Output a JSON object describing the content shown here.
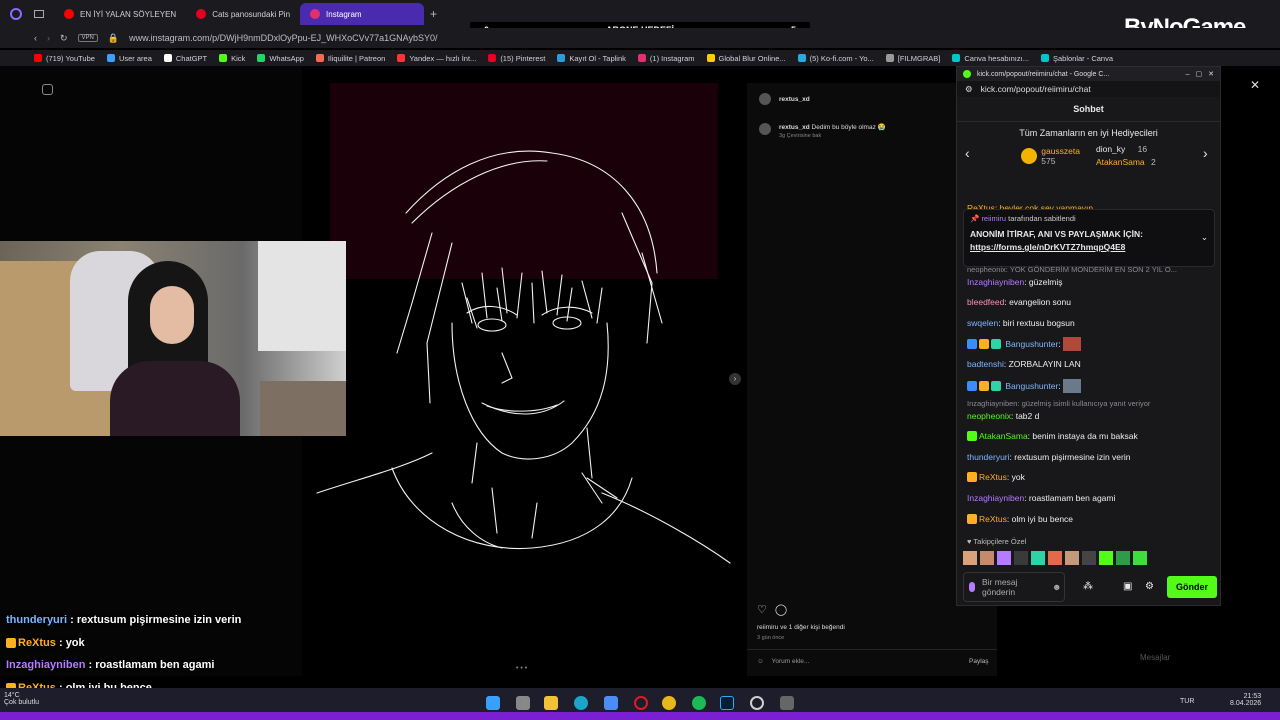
{
  "browser": {
    "tabs": [
      {
        "label": "EN İYİ YALAN SÖYLEYEN",
        "color": "#ff0000",
        "active": false
      },
      {
        "label": "Cats panosundaki Pin",
        "color": "#e60023",
        "active": false
      },
      {
        "label": "Instagram",
        "color": "#e1306c",
        "active": true
      }
    ],
    "url": "www.instagram.com/p/DWjH9nmDDxlOyPpu-EJ_WHXoCVv77a1GNAybSY0/",
    "vpn_label": "VPN",
    "bookmarks": [
      {
        "label": "(719) YouTube",
        "color": "#ff0000"
      },
      {
        "label": "User area",
        "color": "#3aa0ff"
      },
      {
        "label": "ChatGPT",
        "color": "#ffffff"
      },
      {
        "label": "Kick",
        "color": "#53fc18"
      },
      {
        "label": "WhatsApp",
        "color": "#25d366"
      },
      {
        "label": "Iliquilite | Patreon",
        "color": "#f96854"
      },
      {
        "label": "Yandex — hızlı İnt...",
        "color": "#ff3333"
      },
      {
        "label": "(15) Pinterest",
        "color": "#e60023"
      },
      {
        "label": "Kayıt Ol - Taplink",
        "color": "#2d9cdb"
      },
      {
        "label": "(1) Instagram",
        "color": "#e1306c"
      },
      {
        "label": "Global Blur Online...",
        "color": "#ffcc00"
      },
      {
        "label": "(5) Ko-fi.com - Yo...",
        "color": "#29abe0"
      },
      {
        "label": "[FILMGRAB]",
        "color": "#999999"
      },
      {
        "label": "Canva hesabınızı...",
        "color": "#00c4cc"
      },
      {
        "label": "Şablonlar - Canva",
        "color": "#00c4cc"
      }
    ]
  },
  "overlay": {
    "goal_left": "0",
    "goal_label": "ABONE HEDEFİ",
    "goal_right": "5",
    "logo": "ByNoGame"
  },
  "post": {
    "username": "rextus_xd",
    "caption_user": "rextus_xd",
    "caption_text": "Dedim bu böyle olmaz 😭",
    "caption_time": "3g",
    "translate": "Çevirisine bak",
    "likes": "reiimiru ve 1 diğer kişi beğendi",
    "posted": "3 gün önce",
    "comment_placeholder": "Yorum ekle...",
    "share": "Paylaş"
  },
  "kick": {
    "window_title": "kick.com/popout/reiimiru/chat - Google C...",
    "url": "kick.com/popout/reiimiru/chat",
    "header": "Sohbet",
    "gifters_title": "Tüm Zamanların en iyi Hediyecileri",
    "gifters": [
      {
        "name": "gausszeta",
        "count": "575"
      },
      {
        "name": "dion_ky",
        "count": "16"
      },
      {
        "name": "AtakanSama",
        "count": "2"
      }
    ],
    "peek_line": "ReXtus: beyler çok sey yapmayın",
    "pinned_by": "reiimiru",
    "pinned_label": "tarafından sabitlendi",
    "pinned_text": "ANONİM İTİRAF, ANI VS PAYLAŞMAK İÇİN:",
    "pinned_link": "https://forms.gle/nDrKVTZ7hmqpQ4E8",
    "messages": [
      {
        "user": "",
        "text": "neopheonix: YOK GÖNDERİM MONDERİM EN SON 2 YIL O...",
        "user_color": "#8a8a90",
        "reply": true
      },
      {
        "user": "Inzaghiayniben",
        "text": "güzelmiş",
        "user_color": "#b57cff",
        "reply": false
      },
      {
        "user": "bleedfeed",
        "text": "evangelion sonu",
        "user_color": "#ff8fb3",
        "reply": false
      },
      {
        "user": "swqelen",
        "text": "biri rextusu bogsun",
        "user_color": "#7db6ff",
        "reply": false
      },
      {
        "user": "Bangushunter",
        "text": "",
        "user_color": "#7db6ff",
        "reply": false
      },
      {
        "user": "badtenshi",
        "text": "ZORBALAYIN LAN",
        "user_color": "#7db6ff",
        "reply": false
      },
      {
        "user": "Bangushunter",
        "text": "",
        "user_color": "#7db6ff",
        "reply": false
      },
      {
        "user": "",
        "text": "Inzaghiayniben: güzelmiş isimli kullanıcıya yanıt veriyor",
        "user_color": "#8a8a90",
        "reply": true
      },
      {
        "user": "neopheonix",
        "text": "tab2 d",
        "user_color": "#53fc18",
        "reply": false
      },
      {
        "user": "AtakanSama",
        "text": "benim instaya da mı baksak",
        "user_color": "#53fc18",
        "reply": false
      },
      {
        "user": "thunderyuri",
        "text": "rextusum pişirmesine izin verin",
        "user_color": "#7db6ff",
        "reply": false
      },
      {
        "user": "ReXtus",
        "text": "yok",
        "user_color": "#ffb020",
        "reply": false
      },
      {
        "user": "Inzaghiayniben",
        "text": "roastlamam ben agami",
        "user_color": "#b57cff",
        "reply": false
      },
      {
        "user": "ReXtus",
        "text": "olm iyi bu bence",
        "user_color": "#ffb020",
        "reply": false
      }
    ],
    "followers_only": "Takipçilere Özel",
    "input_placeholder": "Bir mesaj gönderin",
    "send": "Gönder"
  },
  "stream_overlay": [
    {
      "user": "thunderyuri",
      "text": "rextusum pişirmesine izin verin",
      "color": "#7db6ff"
    },
    {
      "user": "ReXtus",
      "text": "yok",
      "color": "#ffb020"
    },
    {
      "user": "Inzaghiayniben",
      "text": "roastlamam ben agami",
      "color": "#b57cff"
    },
    {
      "user": "ReXtus",
      "text": "olm iyi bu bence",
      "color": "#ffb020"
    }
  ],
  "weather": {
    "temp": "14°C",
    "desc": "Çok bulutlu"
  },
  "messages_btn": "Mesajlar",
  "system": {
    "lang": "TUR",
    "time": "21:53",
    "date": "8.04.2026"
  }
}
